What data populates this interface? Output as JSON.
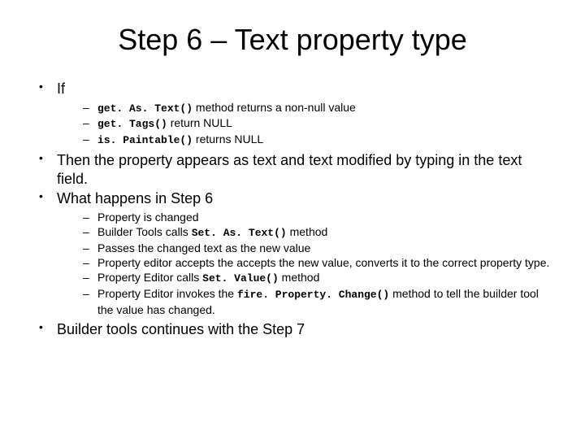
{
  "title": "Step 6 – Text property type",
  "b1": "If",
  "s1a_code": "get. As. Text()",
  "s1a_tail": " method returns a non-null value",
  "s1b_code": "get. Tags()",
  "s1b_tail": " return NULL",
  "s1c_code": "is. Paintable()",
  "s1c_tail": " returns NULL",
  "b2": "Then the property appears as text and text modified by typing in the text field.",
  "b3": "What happens in Step 6",
  "s3a": "Property is changed",
  "s3b_pre": "Builder Tools calls ",
  "s3b_code": "Set. As. Text()",
  "s3b_post": " method",
  "s3c": "Passes the changed text as the new value",
  "s3d": "Property editor accepts the accepts the new value, converts it to the correct property type.",
  "s3e_pre": "Property Editor calls ",
  "s3e_code": "Set. Value()",
  "s3e_post": " method",
  "s3f_pre": "Property Editor invokes the ",
  "s3f_code": "fire. Property. Change()",
  "s3f_post": " method to tell the builder tool the value has changed.",
  "b4": "Builder tools continues with the Step 7"
}
